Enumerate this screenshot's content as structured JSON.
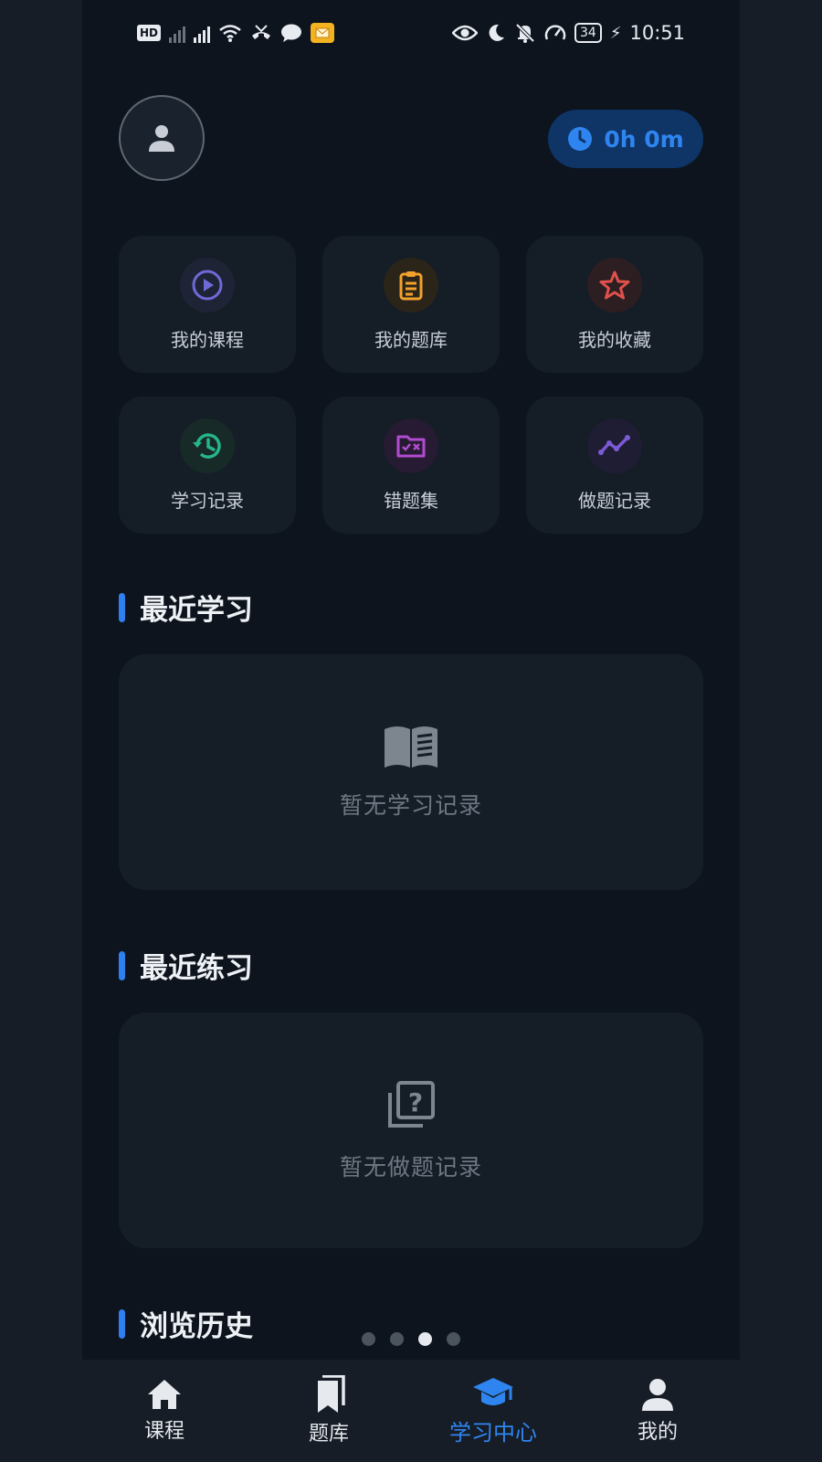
{
  "status_bar": {
    "hd": "HD",
    "battery": "34",
    "time": "10:51"
  },
  "header": {
    "timer": "0h 0m"
  },
  "tiles": [
    {
      "label": "我的课程",
      "icon": "play-circle-icon",
      "color": "#6f69d8",
      "bg": "#1e2336"
    },
    {
      "label": "我的题库",
      "icon": "clipboard-icon",
      "color": "#f2a12c",
      "bg": "#2a2419"
    },
    {
      "label": "我的收藏",
      "icon": "star-icon",
      "color": "#e2504c",
      "bg": "#2d1e22"
    },
    {
      "label": "学习记录",
      "icon": "history-icon",
      "color": "#26b58a",
      "bg": "#172a27"
    },
    {
      "label": "错题集",
      "icon": "wrong-folder-icon",
      "color": "#b24bd0",
      "bg": "#261b32"
    },
    {
      "label": "做题记录",
      "icon": "trend-line-icon",
      "color": "#7b5ad6",
      "bg": "#1f1d34"
    }
  ],
  "sections": {
    "recent_study": {
      "title": "最近学习",
      "empty": "暂无学习记录"
    },
    "recent_practice": {
      "title": "最近练习",
      "empty": "暂无做题记录"
    },
    "browse_history": {
      "title": "浏览历史"
    }
  },
  "pager": {
    "count": 4,
    "active_index": 2
  },
  "bottom_nav": [
    {
      "label": "课程",
      "icon": "home-icon",
      "active": false
    },
    {
      "label": "题库",
      "icon": "books-icon",
      "active": false
    },
    {
      "label": "学习中心",
      "icon": "graduation-cap-icon",
      "active": true
    },
    {
      "label": "我的",
      "icon": "person-icon",
      "active": false
    }
  ]
}
